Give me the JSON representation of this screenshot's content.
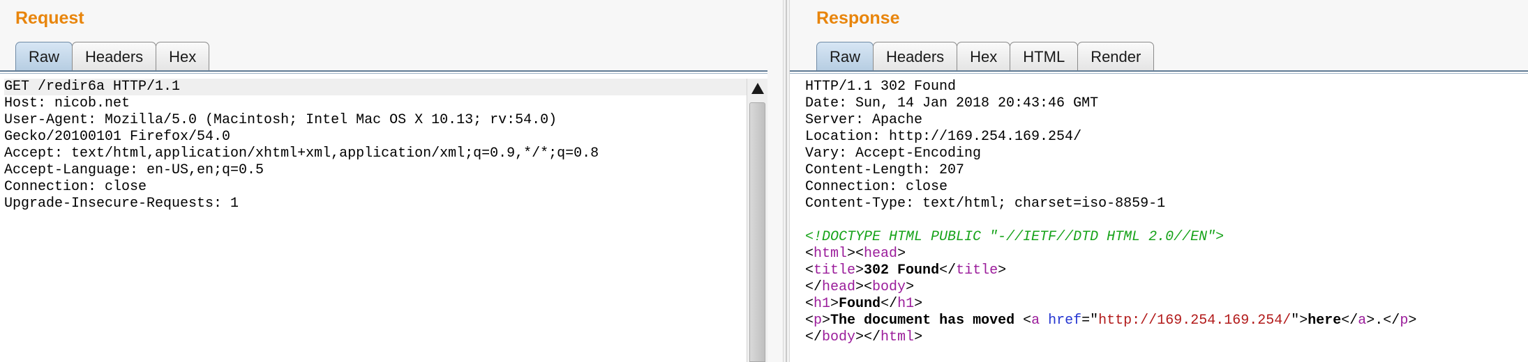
{
  "request": {
    "title": "Request",
    "tabs": [
      "Raw",
      "Headers",
      "Hex"
    ],
    "active_tab": "Raw",
    "lines": [
      "GET /redir6a HTTP/1.1",
      "Host: nicob.net",
      "User-Agent: Mozilla/5.0 (Macintosh; Intel Mac OS X 10.13; rv:54.0)",
      "Gecko/20100101 Firefox/54.0",
      "Accept: text/html,application/xhtml+xml,application/xml;q=0.9,*/*;q=0.8",
      "Accept-Language: en-US,en;q=0.5",
      "Connection: close",
      "Upgrade-Insecure-Requests: 1"
    ]
  },
  "response": {
    "title": "Response",
    "tabs": [
      "Raw",
      "Headers",
      "Hex",
      "HTML",
      "Render"
    ],
    "active_tab": "Raw",
    "header_lines": [
      "HTTP/1.1 302 Found",
      "Date: Sun, 14 Jan 2018 20:43:46 GMT",
      "Server: Apache",
      "Location: http://169.254.169.254/",
      "Vary: Accept-Encoding",
      "Content-Length: 207",
      "Connection: close",
      "Content-Type: text/html; charset=iso-8859-1"
    ],
    "body_lines": [
      [
        {
          "t": "doctype",
          "v": "<!DOCTYPE HTML PUBLIC \"-//IETF//DTD HTML 2.0//EN\">"
        }
      ],
      [
        {
          "t": "punct",
          "v": "<"
        },
        {
          "t": "tag",
          "v": "html"
        },
        {
          "t": "punct",
          "v": "><"
        },
        {
          "t": "tag",
          "v": "head"
        },
        {
          "t": "punct",
          "v": ">"
        }
      ],
      [
        {
          "t": "punct",
          "v": "<"
        },
        {
          "t": "tag",
          "v": "title"
        },
        {
          "t": "punct",
          "v": ">"
        },
        {
          "t": "text",
          "v": "302 Found"
        },
        {
          "t": "punct",
          "v": "</"
        },
        {
          "t": "tag",
          "v": "title"
        },
        {
          "t": "punct",
          "v": ">"
        }
      ],
      [
        {
          "t": "punct",
          "v": "</"
        },
        {
          "t": "tag",
          "v": "head"
        },
        {
          "t": "punct",
          "v": "><"
        },
        {
          "t": "tag",
          "v": "body"
        },
        {
          "t": "punct",
          "v": ">"
        }
      ],
      [
        {
          "t": "punct",
          "v": "<"
        },
        {
          "t": "tag",
          "v": "h1"
        },
        {
          "t": "punct",
          "v": ">"
        },
        {
          "t": "text",
          "v": "Found"
        },
        {
          "t": "punct",
          "v": "</"
        },
        {
          "t": "tag",
          "v": "h1"
        },
        {
          "t": "punct",
          "v": ">"
        }
      ],
      [
        {
          "t": "punct",
          "v": "<"
        },
        {
          "t": "tag",
          "v": "p"
        },
        {
          "t": "punct",
          "v": ">"
        },
        {
          "t": "text",
          "v": "The document has moved "
        },
        {
          "t": "punct",
          "v": "<"
        },
        {
          "t": "tag",
          "v": "a"
        },
        {
          "t": "punct",
          "v": " "
        },
        {
          "t": "attr",
          "v": "href"
        },
        {
          "t": "punct",
          "v": "=\""
        },
        {
          "t": "str",
          "v": "http://169.254.169.254/"
        },
        {
          "t": "punct",
          "v": "\">"
        },
        {
          "t": "text",
          "v": "here"
        },
        {
          "t": "punct",
          "v": "</"
        },
        {
          "t": "tag",
          "v": "a"
        },
        {
          "t": "punct",
          "v": ">."
        },
        {
          "t": "punct",
          "v": "</"
        },
        {
          "t": "tag",
          "v": "p"
        },
        {
          "t": "punct",
          "v": ">"
        }
      ],
      [
        {
          "t": "punct",
          "v": "</"
        },
        {
          "t": "tag",
          "v": "body"
        },
        {
          "t": "punct",
          "v": "></"
        },
        {
          "t": "tag",
          "v": "html"
        },
        {
          "t": "punct",
          "v": ">"
        }
      ]
    ]
  },
  "colors": {
    "title": "#e8850c",
    "active_tab": "#c6d9ec",
    "doctype": "#17a31a",
    "tag": "#9b1d9b",
    "attr": "#2435d1",
    "string": "#b21a1a"
  }
}
